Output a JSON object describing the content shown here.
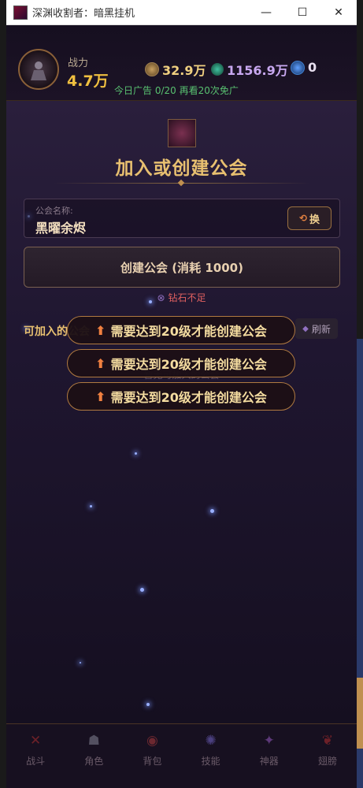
{
  "window": {
    "title": "深渊收割者：暗黑挂机",
    "minimize": "—",
    "maximize": "☐",
    "close": "✕"
  },
  "header": {
    "power_label": "战力",
    "power_value": "4.7万",
    "gold": "32.9万",
    "soul": "1156.9万",
    "gems": "0",
    "ad_text": "今日广告 0/20  再看20次免广"
  },
  "guild": {
    "title": "加入或创建公会",
    "name_label": "公会名称:",
    "name_value": "黑曜余烬",
    "swap_label": "换",
    "create_label": "创建公会 (消耗 1000)",
    "warning": "钻石不足",
    "joinable_label": "可加入的公会",
    "refresh_label": "刷新",
    "empty_hint": "暂无可加入的公会"
  },
  "toasts": [
    "需要达到20级才能创建公会",
    "需要达到20级才能创建公会",
    "需要达到20级才能创建公会"
  ],
  "nav": [
    {
      "label": "战斗",
      "icon": "sword-icon"
    },
    {
      "label": "角色",
      "icon": "character-icon"
    },
    {
      "label": "背包",
      "icon": "bag-icon"
    },
    {
      "label": "技能",
      "icon": "skill-icon"
    },
    {
      "label": "神器",
      "icon": "artifact-icon"
    },
    {
      "label": "翅膀",
      "icon": "wings-icon"
    }
  ],
  "colors": {
    "accent_gold": "#e8c070",
    "warning_red": "#e06060",
    "ad_green": "#58c070",
    "background": "#110b19"
  }
}
